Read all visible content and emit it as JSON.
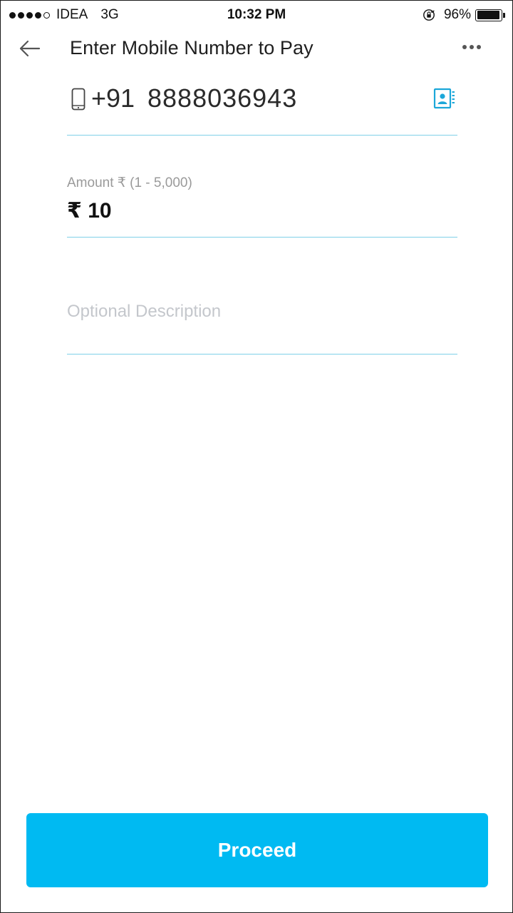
{
  "status_bar": {
    "carrier": "IDEA",
    "network": "3G",
    "time": "10:32 PM",
    "battery_percent": "96%",
    "battery_level": 0.96,
    "signal_bars_filled": 4,
    "signal_bars_total": 5
  },
  "header": {
    "title": "Enter Mobile Number to Pay",
    "back_icon": "arrow-left-icon",
    "more_icon": "more-dots-icon"
  },
  "phone": {
    "country_code": "+91",
    "number": "8888036943",
    "phone_icon": "mobile-phone-icon",
    "contacts_icon": "contact-book-icon"
  },
  "amount": {
    "label": "Amount ₹ (1 - 5,000)",
    "value": "₹ 10"
  },
  "description": {
    "placeholder": "Optional Description"
  },
  "proceed": {
    "label": "Proceed"
  },
  "colors": {
    "accent": "#00baf2",
    "underline": "#7fd0e8",
    "placeholder": "#c4c7cc",
    "label_gray": "#9a9a9a"
  }
}
